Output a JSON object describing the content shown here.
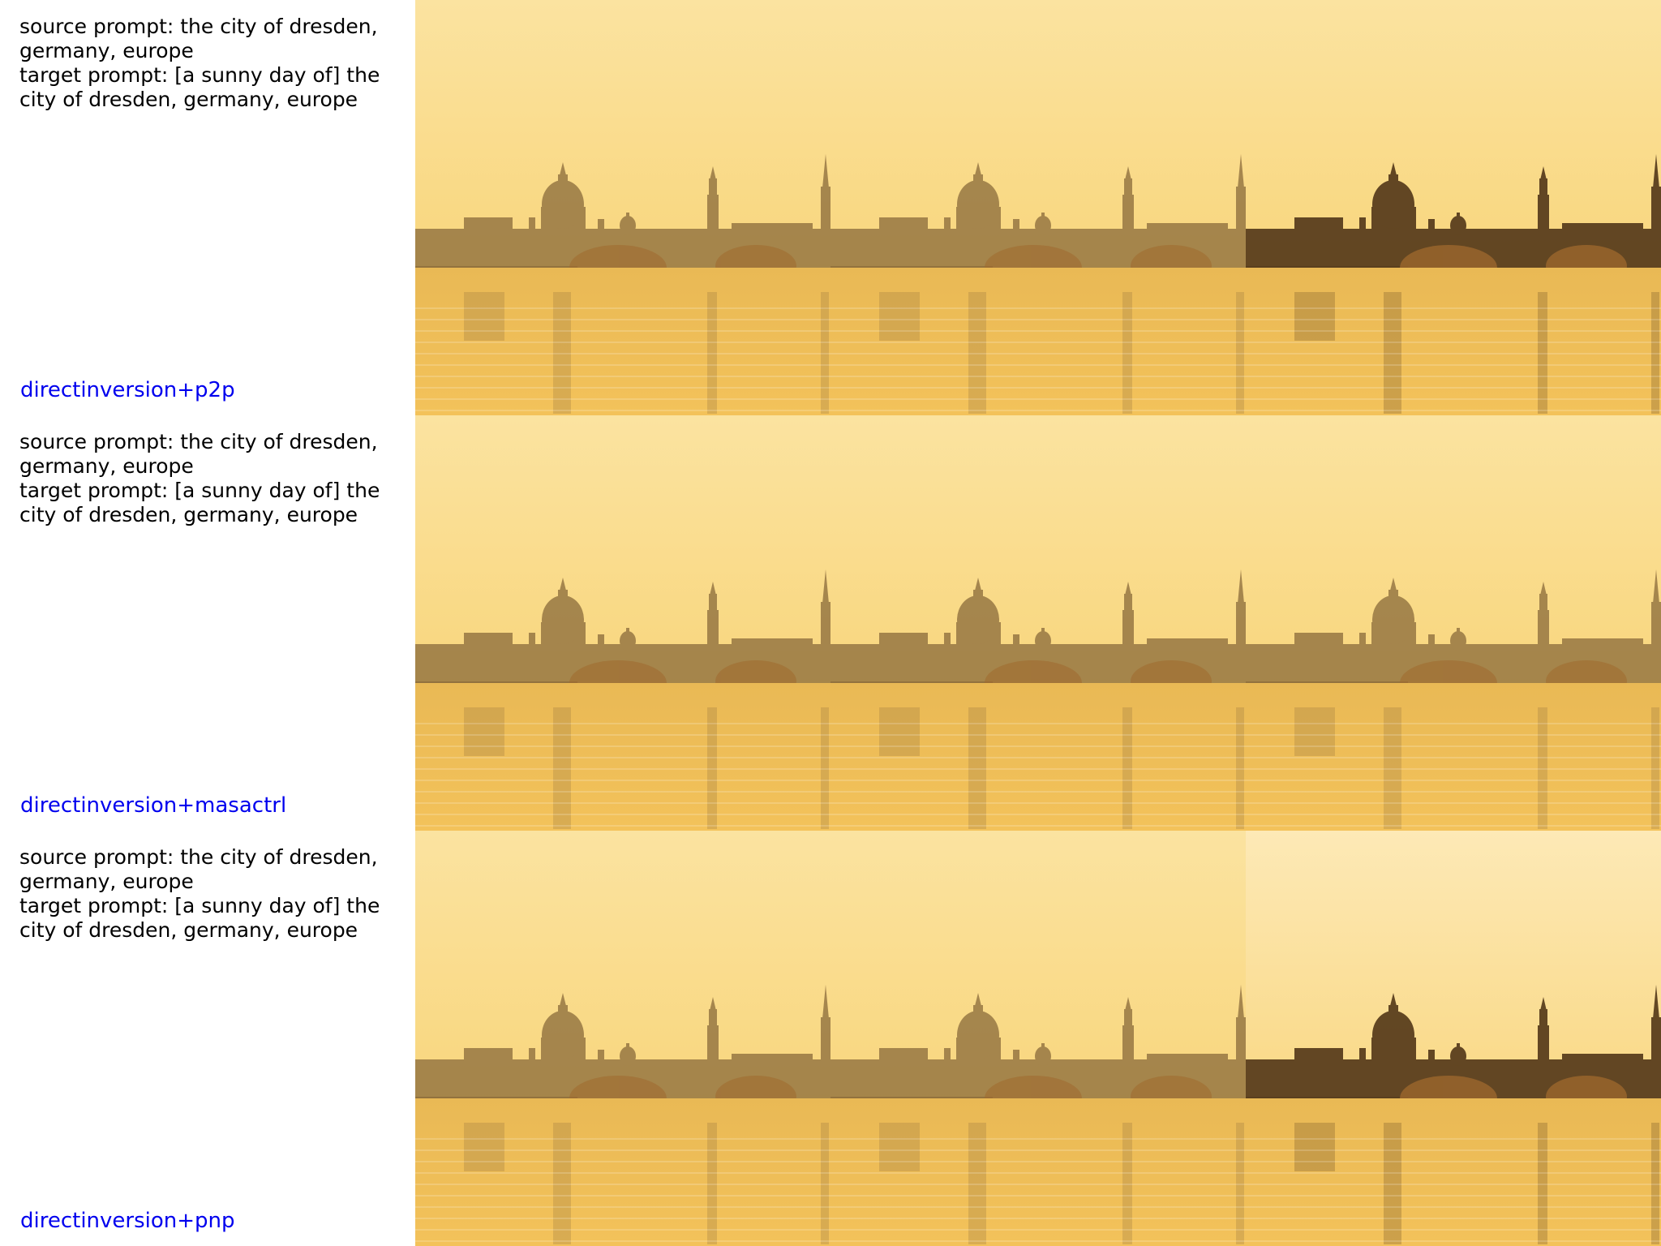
{
  "rows": [
    {
      "source_prompt": "source prompt: the city of dresden, germany, europe",
      "target_prompt": "target prompt: [a sunny day of] the city of dresden, germany, europe",
      "method": "directinversion+p2p",
      "images": [
        {
          "variant": "hazy"
        },
        {
          "variant": "hazy"
        },
        {
          "variant": "detailed"
        }
      ]
    },
    {
      "source_prompt": "source prompt: the city of dresden, germany, europe",
      "target_prompt": "target prompt: [a sunny day of] the city of dresden, germany, europe",
      "method": "directinversion+masactrl",
      "images": [
        {
          "variant": "hazy"
        },
        {
          "variant": "hazy"
        },
        {
          "variant": "hazy"
        }
      ]
    },
    {
      "source_prompt": "source prompt: the city of dresden, germany, europe",
      "target_prompt": "target prompt: [a sunny day of] the city of dresden, germany, europe",
      "method": "directinversion+pnp",
      "images": [
        {
          "variant": "hazy"
        },
        {
          "variant": "hazy"
        },
        {
          "variant": "bright"
        }
      ]
    }
  ],
  "colors": {
    "method_label": "#0000ee",
    "prompt_text": "#000000",
    "sky_top": "#fbe3a0",
    "sky_bottom": "#f7cf6a",
    "water": "#f3c25a",
    "silhouette": "#8a6a3a"
  }
}
